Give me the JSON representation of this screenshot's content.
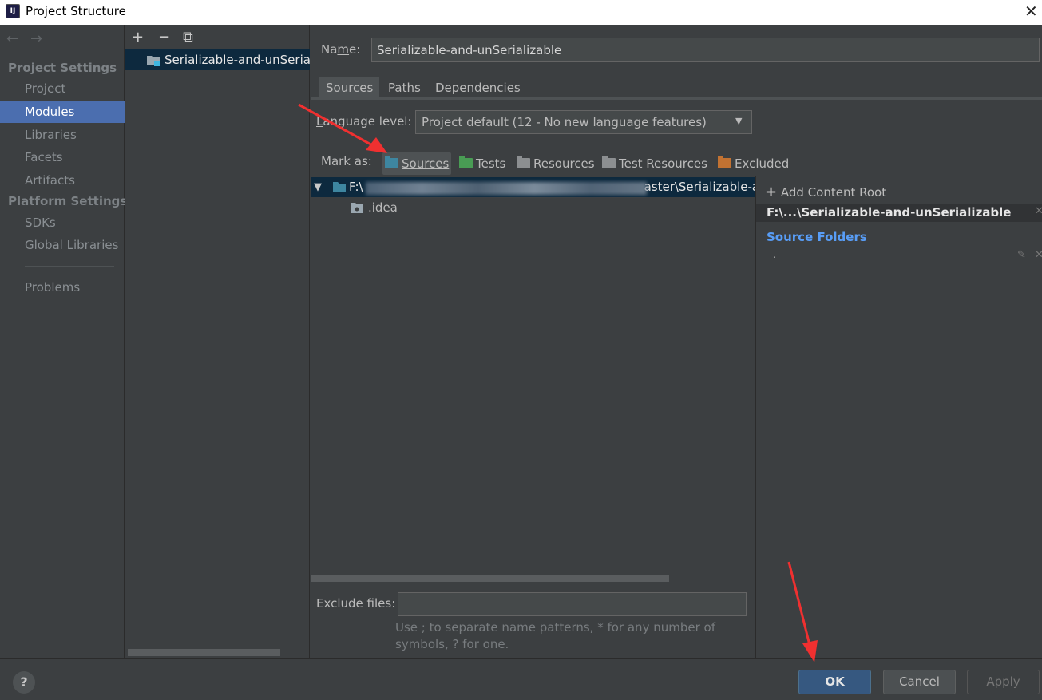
{
  "window": {
    "title": "Project Structure",
    "app_icon": "IJ"
  },
  "nav": {
    "back_icon": "←",
    "forward_icon": "→",
    "project_settings_header": "Project Settings",
    "platform_settings_header": "Platform Settings",
    "items": [
      {
        "label": "Project"
      },
      {
        "label": "Modules",
        "selected": true
      },
      {
        "label": "Libraries"
      },
      {
        "label": "Facets"
      },
      {
        "label": "Artifacts"
      },
      {
        "label": "SDKs"
      },
      {
        "label": "Global Libraries"
      },
      {
        "label": "Problems"
      }
    ]
  },
  "modules": {
    "add_icon": "+",
    "remove_icon": "−",
    "copy_icon": "⧉",
    "selected_module": "Serializable-and-unSerializable"
  },
  "module_settings": {
    "name_label": "Name:",
    "name_value": "Serializable-and-unSerializable",
    "tabs": [
      "Sources",
      "Paths",
      "Dependencies"
    ],
    "active_tab": "Sources",
    "language_level_label": "Language level:",
    "language_level_value": "Project default (12 - No new language features)",
    "mark_as_label": "Mark as:",
    "mark_as": [
      {
        "label": "Sources",
        "color": "#3e86a0"
      },
      {
        "label": "Tests",
        "color": "#499c54"
      },
      {
        "label": "Resources",
        "color": "#8c8f91"
      },
      {
        "label": "Test Resources",
        "color": "#8c8f91"
      },
      {
        "label": "Excluded",
        "color": "#c27232"
      }
    ],
    "tree": {
      "root_prefix": "F:\\",
      "root_suffix": "aster\\Serializable-and-unSerializable",
      "child": ".idea"
    },
    "exclude_files_label": "Exclude files:",
    "exclude_hint_line1": "Use ; to separate name patterns, * for any number of",
    "exclude_hint_line2": "symbols, ? for one."
  },
  "content_root": {
    "add_label": "Add Content Root",
    "path": "F:\\...\\Serializable-and-unSerializable",
    "source_folders_label": "Source Folders",
    "source_folder_entry": "."
  },
  "buttons": {
    "help": "?",
    "ok": "OK",
    "cancel": "Cancel",
    "apply": "Apply"
  },
  "colors": {
    "accent": "#4b6eaf",
    "selection": "#0d293e",
    "link": "#589df6"
  }
}
